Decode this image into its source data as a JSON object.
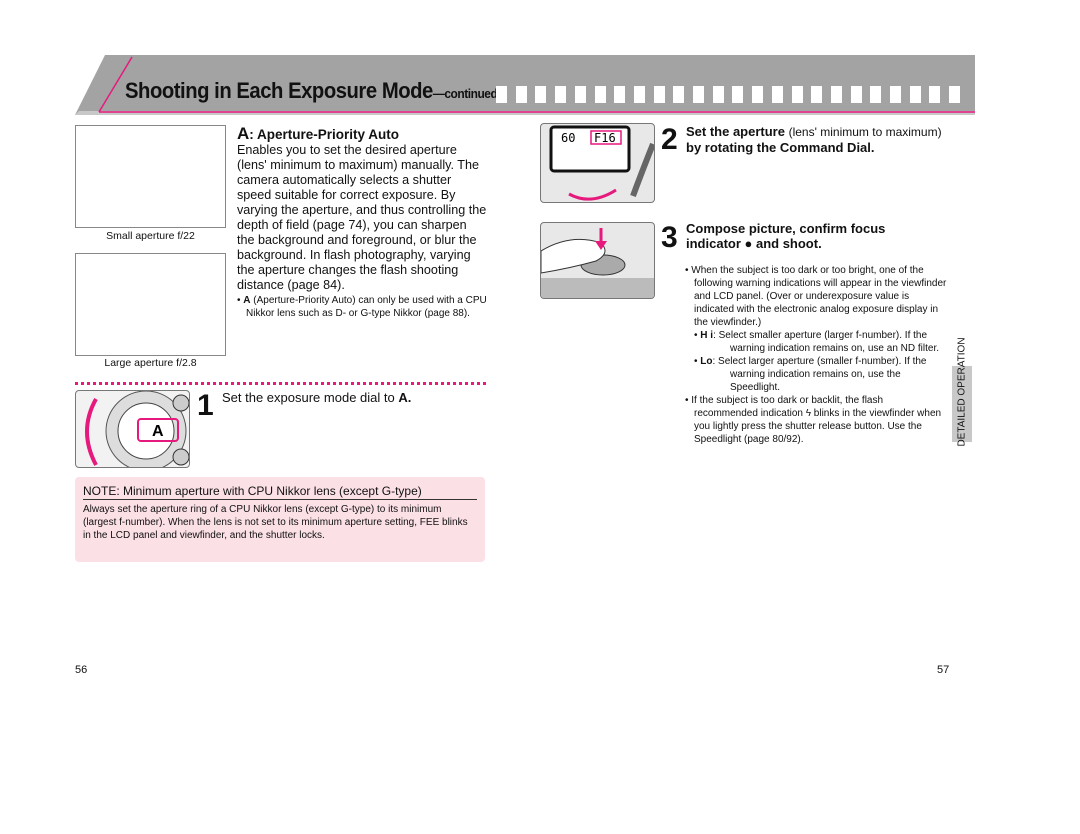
{
  "header": {
    "title": "Shooting in Each Exposure Mode",
    "suffix": "—continued"
  },
  "left": {
    "photos": [
      {
        "caption": "Small aperture  f/22"
      },
      {
        "caption": "Large aperture  f/2.8"
      }
    ],
    "section": {
      "mode_letter": "A",
      "heading": ": Aperture-Priority Auto",
      "body": "Enables you to set the desired aperture (lens' minimum to maximum) manually. The camera automatically selects a shutter speed suitable for correct exposure. By varying the aperture, and thus controlling the depth of field (page 74), you can sharpen the background and foreground, or blur the background. In flash photography, varying the aperture changes the flash shooting distance (page 84).",
      "note_letter": "A",
      "note": " (Aperture-Priority Auto) can only be used with a CPU Nikkor lens such as D- or G-type Nikkor (page 88)."
    },
    "step1": {
      "num": "1",
      "text": "Set the exposure mode dial to ",
      "bold_letter": "A."
    },
    "note_box": {
      "title": "NOTE: Minimum aperture with CPU Nikkor lens (except G-type)",
      "body": "Always set the aperture ring of a CPU Nikkor lens (except G-type) to its minimum (largest f-number). When the lens is not set to its minimum aperture setting, FEE blinks in the LCD panel and viewfinder, and the shutter locks."
    },
    "page_number": "56"
  },
  "right": {
    "step2": {
      "num": "2",
      "text_a": "Set the aperture ",
      "text_paren": "(lens' minimum to maximum)",
      "text_b": " by rotating the Command Dial."
    },
    "lcd": {
      "shutter": "60",
      "aperture": "F16"
    },
    "step3": {
      "num": "3",
      "text": "Compose picture, confirm focus indicator ● and shoot."
    },
    "bullets": {
      "b1": "When the subject is too dark or too bright, one of the following warning indications will appear in the viewfinder and LCD panel. (Over or underexposure value is indicated with the electronic analog exposure display in the viewfinder.)",
      "hi_code": "H i",
      "hi_text": ": Select smaller aperture (larger f-number). If the warning indication remains on, use an ND filter.",
      "lo_code": "Lo",
      "lo_text": ": Select larger aperture (smaller f-number). If the warning indication remains on, use the Speedlight.",
      "b2": "If the subject is too dark or backlit, the flash recommended indication ϟ blinks in the viewfinder when you lightly press the shutter release button. Use the Speedlight (page 80/92)."
    },
    "side_tab": "DETAILED OPERATION",
    "page_number": "57"
  },
  "colors": {
    "accent": "#e6197d",
    "header_gray": "#a0a0a0",
    "note_bg": "#fbe0e6"
  }
}
